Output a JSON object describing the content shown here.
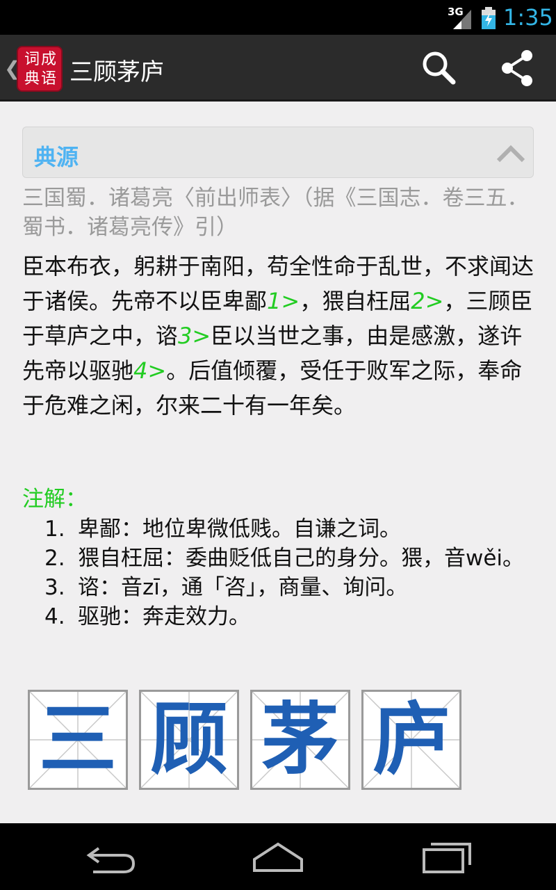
{
  "status_bar": {
    "network": "3G",
    "time": "1:35",
    "clock_color": "#33b5e5"
  },
  "action_bar": {
    "logo_text": "词成典语",
    "title": "三顾茅庐",
    "icons": [
      "back-caret-icon",
      "search-icon",
      "share-icon"
    ]
  },
  "section": {
    "title": "典源",
    "title_color": "#4fb3f2"
  },
  "source": "三国蜀．诸葛亮〈前出师表〉（据《三国志．卷三五．蜀书．诸葛亮传》引）",
  "body": [
    {
      "text": "臣本布衣，躬耕于南阳，苟全性命于乱世，不求闻达于诸侯。先帝不以臣卑鄙"
    },
    {
      "ref": "1>"
    },
    {
      "text": "，猥自枉屈"
    },
    {
      "ref": "2>"
    },
    {
      "text": "，三顾臣于草庐之中，谘"
    },
    {
      "ref": "3>"
    },
    {
      "text": "臣以当世之事，由是感激，遂许先帝以驱驰"
    },
    {
      "ref": "4>"
    },
    {
      "text": "。后值倾覆，受任于败军之际，奉命于危难之闲，尔来二十有一年矣。"
    }
  ],
  "notes": {
    "title": "注解：",
    "items": [
      {
        "num": "1.",
        "text": "卑鄙：地位卑微低贱。自谦之词。"
      },
      {
        "num": "2.",
        "text": "猥自枉屈：委曲贬低自己的身分。猥，音wěi。"
      },
      {
        "num": "3.",
        "text": "谘：音zī，通「咨」，商量、询问。"
      },
      {
        "num": "4.",
        "text": "驱驰：奔走效力。"
      }
    ]
  },
  "characters": [
    "三",
    "顾",
    "茅",
    "庐"
  ],
  "char_color": "#1f5fb4",
  "nav": [
    "back-icon",
    "home-icon",
    "recent-apps-icon"
  ]
}
